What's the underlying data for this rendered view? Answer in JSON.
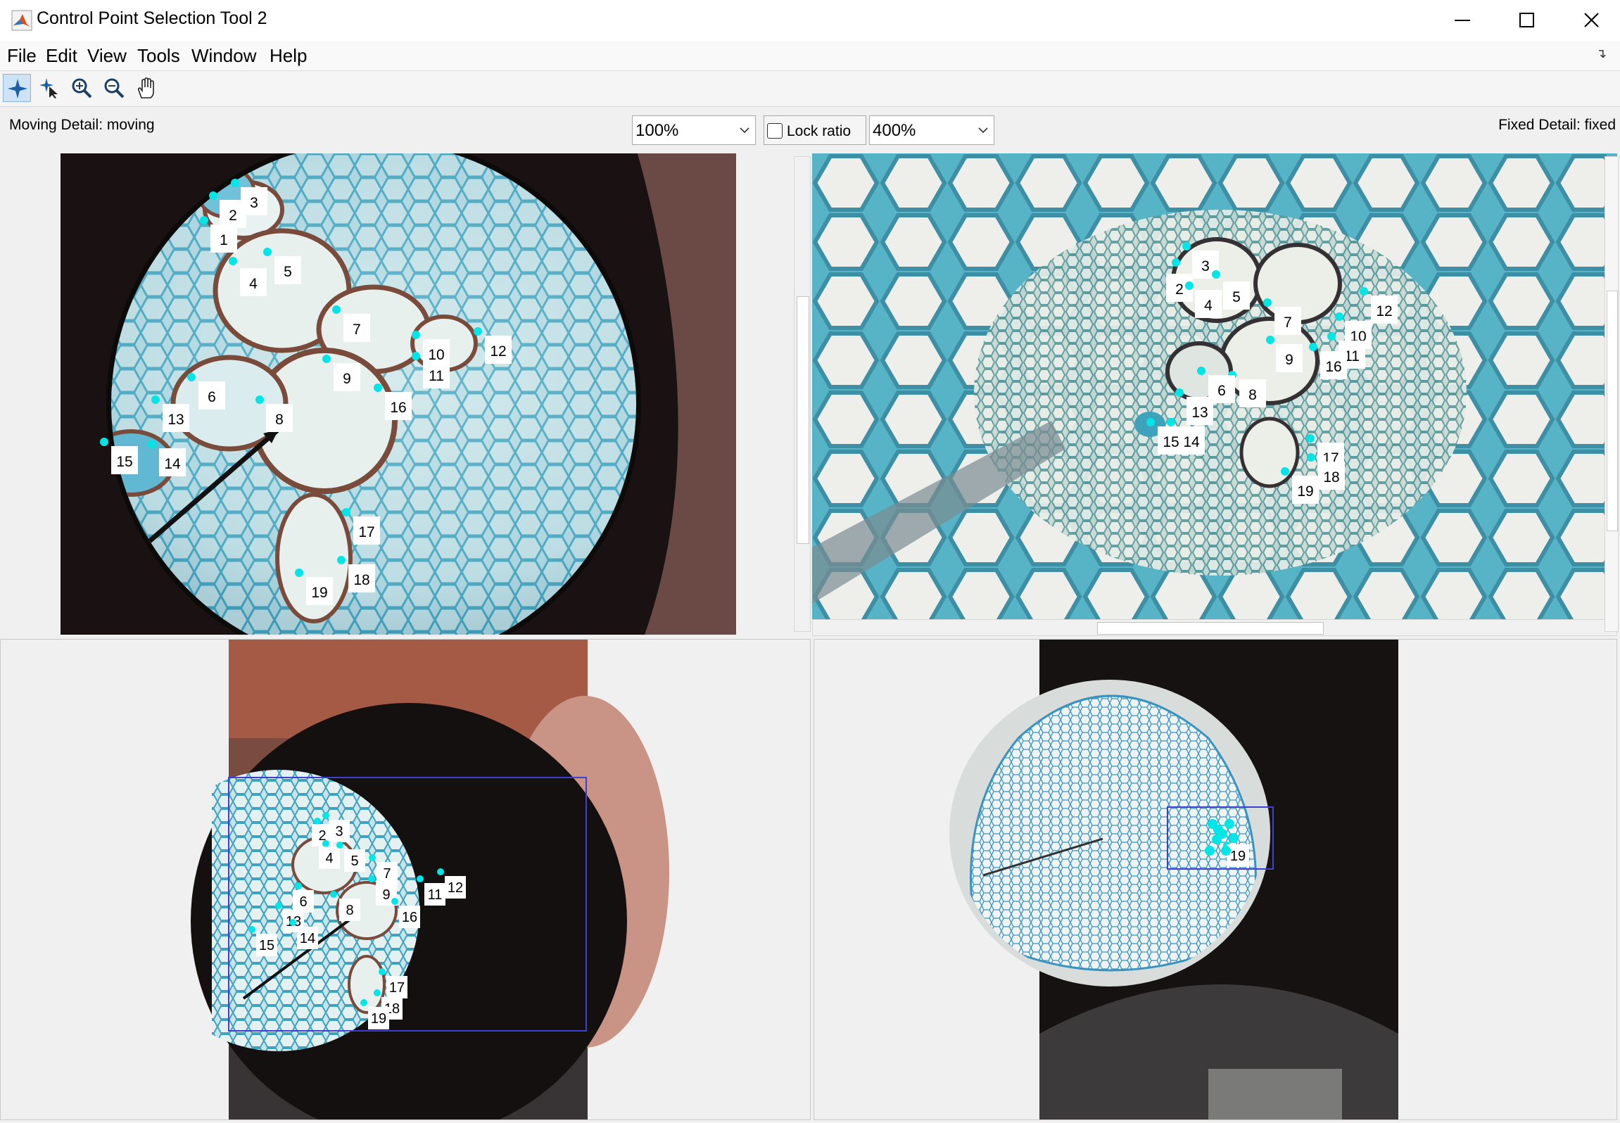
{
  "window": {
    "title": "Control Point Selection Tool 2"
  },
  "menu": [
    "File",
    "Edit",
    "View",
    "Tools",
    "Window",
    "Help"
  ],
  "toolbar": [
    {
      "icon": "add-point-icon",
      "active": true
    },
    {
      "icon": "select-point-icon",
      "active": false
    },
    {
      "icon": "zoom-in-icon",
      "active": false
    },
    {
      "icon": "zoom-out-icon",
      "active": false
    },
    {
      "icon": "pan-hand-icon",
      "active": false
    }
  ],
  "detail": {
    "moving_label": "Moving Detail: moving",
    "fixed_label": "Fixed Detail: fixed",
    "moving_zoom": "100%",
    "fixed_zoom": "400%",
    "lock_ratio_label": "Lock ratio",
    "lock_ratio_checked": false
  },
  "colors": {
    "point": "#00e5e5",
    "overview_box": "#4040d0",
    "stain_blue": "#4fb0c8",
    "thick_wall": "#7a4a3a",
    "background_dark": "#201616"
  },
  "moving_points": [
    "1",
    "2",
    "3",
    "4",
    "5",
    "6",
    "7",
    "8",
    "9",
    "10",
    "11",
    "12",
    "13",
    "14",
    "15",
    "16",
    "17",
    "18",
    "19"
  ],
  "fixed_points": [
    "2",
    "3",
    "4",
    "5",
    "7",
    "8",
    "9",
    "10",
    "11",
    "12",
    "6",
    "13",
    "14",
    "15",
    "16",
    "17",
    "18",
    "19"
  ],
  "moving_overview_points": [
    "2",
    "3",
    "4",
    "5",
    "6",
    "7",
    "8",
    "9",
    "11",
    "12",
    "13",
    "14",
    "15",
    "16",
    "17",
    "18",
    "19"
  ],
  "fixed_overview_points": [
    "19"
  ]
}
